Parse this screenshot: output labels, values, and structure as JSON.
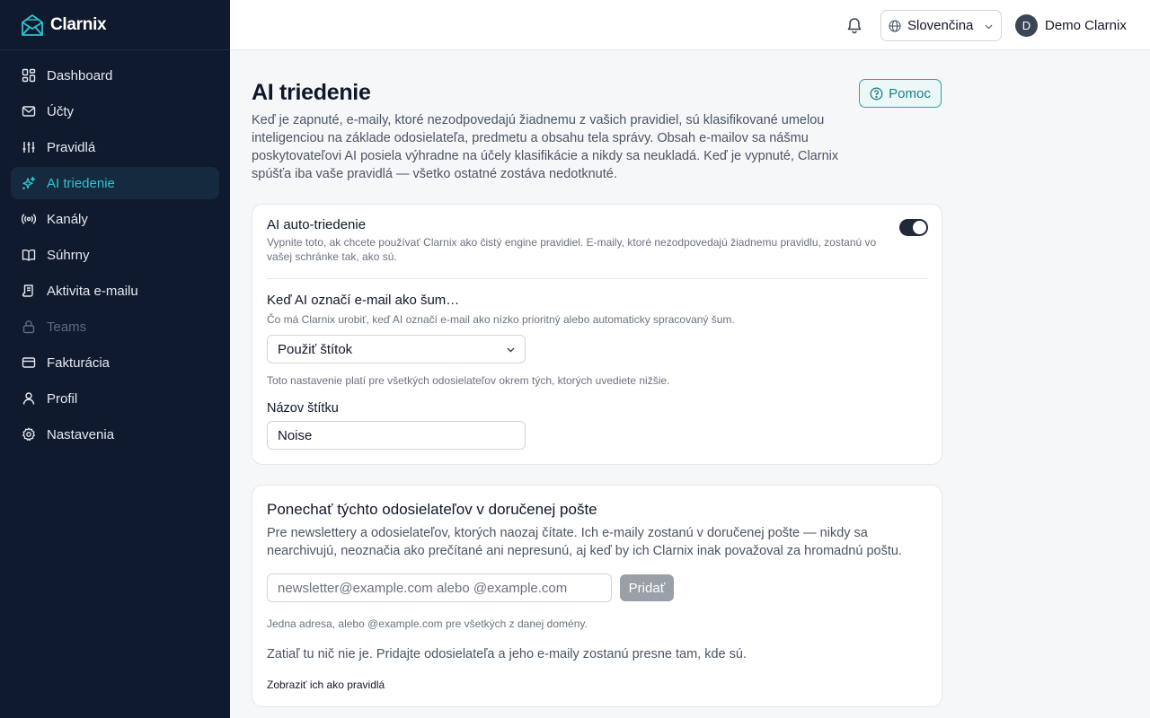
{
  "app": {
    "name": "Clarnix"
  },
  "sidebar": {
    "items": [
      {
        "label": "Dashboard",
        "icon": "dashboard-icon"
      },
      {
        "label": "Účty",
        "icon": "mail-icon"
      },
      {
        "label": "Pravidlá",
        "icon": "sliders-icon"
      },
      {
        "label": "AI triedenie",
        "icon": "sparkles-icon",
        "active": true
      },
      {
        "label": "Kanály",
        "icon": "radio-icon"
      },
      {
        "label": "Súhrny",
        "icon": "book-icon"
      },
      {
        "label": "Aktivita e-mailu",
        "icon": "scroll-icon"
      },
      {
        "label": "Teams",
        "icon": "lock-icon",
        "disabled": true
      },
      {
        "label": "Fakturácia",
        "icon": "credit-card-icon"
      },
      {
        "label": "Profil",
        "icon": "user-icon"
      },
      {
        "label": "Nastavenia",
        "icon": "gear-icon"
      }
    ]
  },
  "header": {
    "language": "Slovenčina",
    "user": {
      "initial": "D",
      "name": "Demo Clarnix"
    }
  },
  "page": {
    "title": "AI triedenie",
    "help_label": "Pomoc",
    "description": "Keď je zapnuté, e-maily, ktoré nezodpovedajú žiadnemu z vašich pravidiel, sú klasifikované umelou inteligenciou na základe odosielateľa, predmetu a obsahu tela správy. Obsah e-mailov sa nášmu poskytovateľovi AI posiela výhradne na účely klasifikácie a nikdy sa neukladá. Keď je vypnuté, Clarnix spúšťa iba vaše pravidlá — všetko ostatné zostáva nedotknuté."
  },
  "auto_sort": {
    "title": "AI auto-triedenie",
    "subtitle": "Vypnite toto, ak chcete používať Clarnix ako čistý engine pravidiel. E-maily, ktoré nezodpovedajú žiadnemu pravidlu, zostanú vo vašej schránke tak, ako sú.",
    "enabled": true,
    "noise_title": "Keď AI označí e-mail ako šum…",
    "noise_subtitle": "Čo má Clarnix urobiť, keď AI označí e-mail ako nízko prioritný alebo automaticky spracovaný šum.",
    "action_value": "Použiť štítok",
    "scope_note": "Toto nastavenie platí pre všetkých odosielateľov okrem tých, ktorých uvediete nižšie.",
    "label_title": "Názov štítku",
    "label_value": "Noise"
  },
  "keep_senders": {
    "title": "Ponechať týchto odosielateľov v doručenej pošte",
    "description": "Pre newslettery a odosielateľov, ktorých naozaj čítate. Ich e-maily zostanú v doručenej pošte — nikdy sa nearchivujú, neoznačia ako prečítané ani nepresunú, aj keď by ich Clarnix inak považoval za hromadnú poštu.",
    "input_placeholder": "newsletter@example.com alebo @example.com",
    "add_label": "Pridať",
    "hint": "Jedna adresa, alebo @example.com pre všetkých z danej domény.",
    "empty_text": "Zatiaľ tu nič nie je. Pridajte odosielateľa a jeho e-maily zostanú presne tam, kde sú.",
    "rules_link": "Zobraziť ich ako pravidlá"
  },
  "colors": {
    "sidebar_bg": "#101a2e",
    "accent": "#2cc4cf",
    "help_border": "#2aa3ad",
    "toggle_on": "#1f2937",
    "add_button": "#9aa0a8"
  }
}
